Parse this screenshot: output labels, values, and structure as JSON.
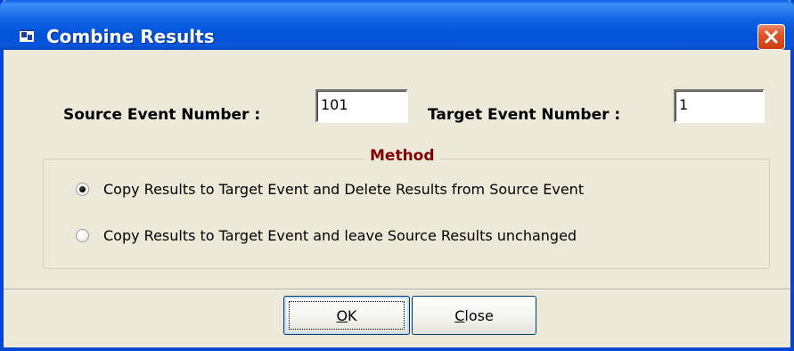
{
  "window": {
    "title": "Combine Results",
    "icon": "results-window-icon",
    "close_icon": "close-x-icon"
  },
  "fields": {
    "source_label": "Source Event Number :",
    "source_value": "101",
    "target_label": "Target Event Number :",
    "target_value": "1"
  },
  "method": {
    "title": "Method",
    "options": [
      {
        "label": "Copy Results to Target Event and Delete Results from Source Event",
        "checked": true
      },
      {
        "label": "Copy Results to Target Event and leave Source Results unchanged",
        "checked": false
      }
    ]
  },
  "buttons": {
    "ok_label_first": "O",
    "ok_label_rest": "K",
    "close_label_first": "C",
    "close_label_rest": "lose"
  },
  "colors": {
    "titlebar": "#0052d6",
    "face": "#ece9d8",
    "group_title": "#800000",
    "close_button": "#e0572d"
  }
}
